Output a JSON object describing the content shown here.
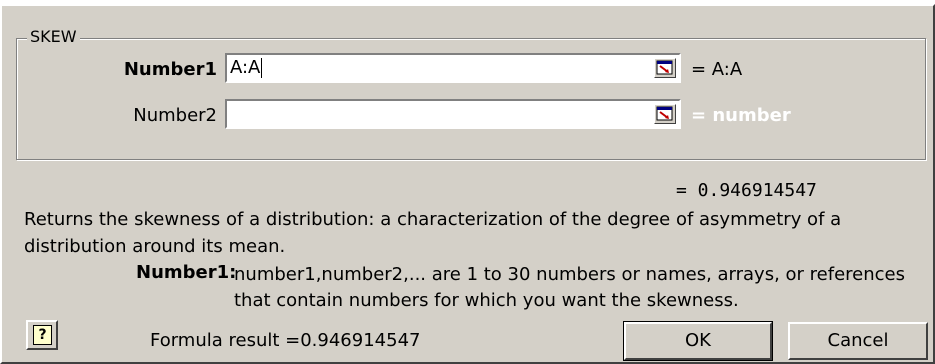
{
  "function_name": "SKEW",
  "arguments": [
    {
      "label": "Number1",
      "value": "A:A",
      "result": "= A:A"
    },
    {
      "label": "Number2",
      "value": "",
      "result": "= number"
    }
  ],
  "result_line": "= 0.946914547",
  "description": "Returns the skewness of a distribution: a characterization of the degree of asymmetry of a distribution around its mean.",
  "arg_help": {
    "name": "Number1:",
    "text": "number1,number2,... are 1 to 30 numbers or names, arrays, or references that contain numbers for which you want the skewness."
  },
  "formula_result": "Formula result =0.946914547",
  "buttons": {
    "ok": "OK",
    "cancel": "Cancel"
  },
  "icons": {
    "collapse": "collapse-dialog-icon",
    "help": "help-icon"
  }
}
